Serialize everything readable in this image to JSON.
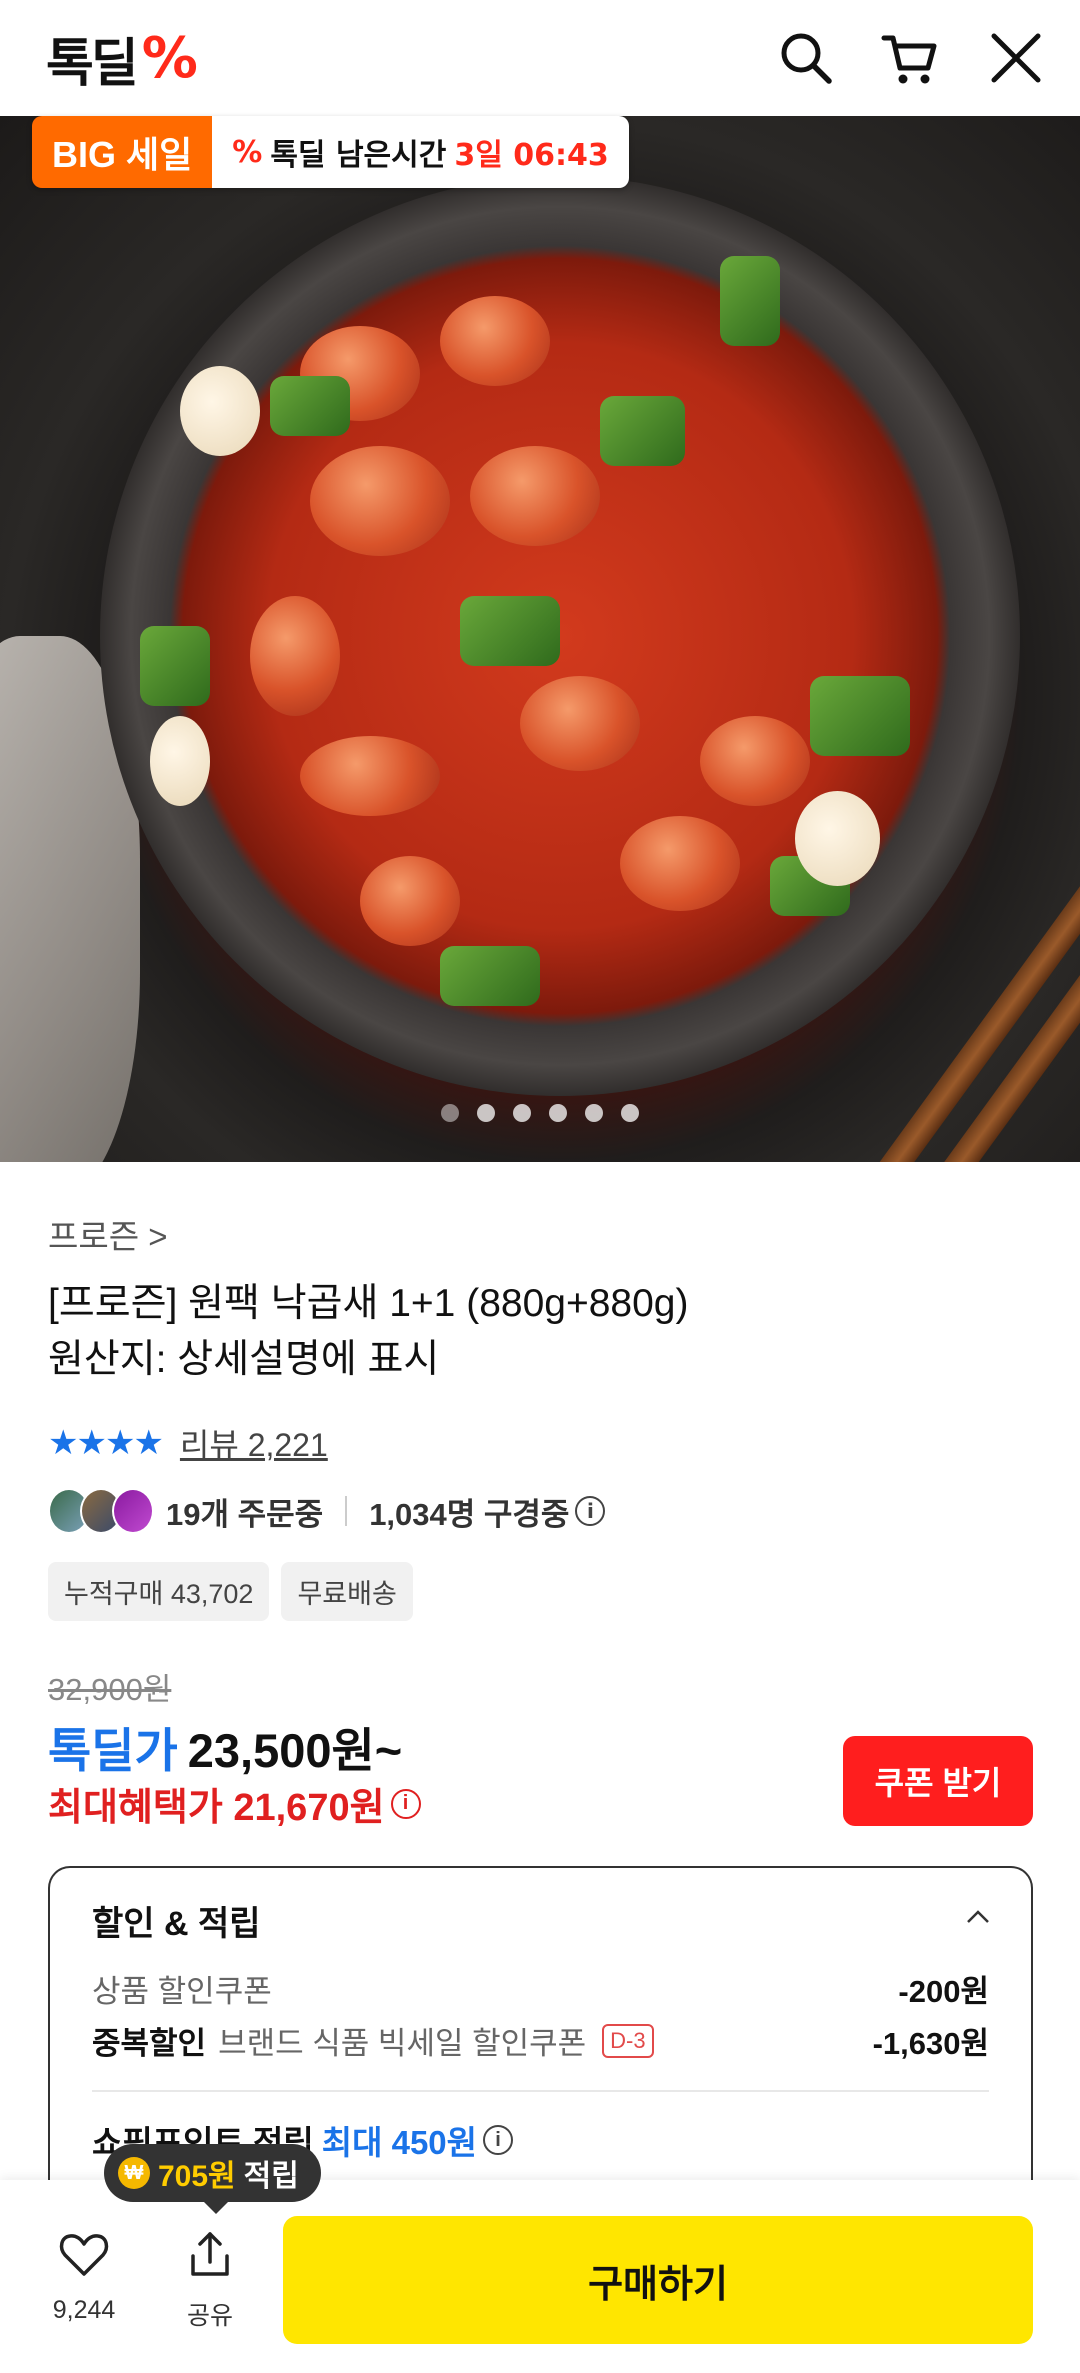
{
  "header": {
    "logo_text": "톡딜",
    "logo_symbol": "%",
    "icons": [
      "search-icon",
      "cart-icon",
      "close-icon"
    ]
  },
  "hero": {
    "sale_badge": "BIG 세일",
    "timer_label": "톡딜 남은시간",
    "timer_value": "3일 06:43",
    "carousel_count": 6
  },
  "product": {
    "category": "프로즌 >",
    "title_line1": "[프로즌] 원팩 낙곱새 1+1 (880g+880g)",
    "title_line2": "원산지: 상세설명에 표시",
    "stars": "★★★★",
    "review_label": "리뷰 2,221",
    "orders_text": "19개 주문중",
    "viewers_text": "1,034명 구경중",
    "chips": [
      "누적구매 43,702",
      "무료배송"
    ]
  },
  "price": {
    "original": "32,900원",
    "deal_label": "톡딜가",
    "deal_price": "23,500원~",
    "max_benefit": "최대혜택가 21,670원",
    "coupon_button": "쿠폰 받기"
  },
  "discount": {
    "heading": "할인 & 적립",
    "rows": [
      {
        "label": "상품 할인쿠폰",
        "bold": "",
        "tag": "",
        "amount": "-200원"
      },
      {
        "label": "브랜드 식품 빅세일 할인쿠폰",
        "bold": "중복할인",
        "tag": "D-3",
        "amount": "-1,630원"
      }
    ],
    "points_label": "쇼핑포인트 적립",
    "points_max": "최대 450원"
  },
  "bottom": {
    "tooltip_amount": "705원",
    "tooltip_suffix": "적립",
    "like_count": "9,244",
    "share_label": "공유",
    "buy_label": "구매하기"
  },
  "colors": {
    "accent_blue": "#1a73e8",
    "accent_red": "#e02020",
    "buy_yellow": "#ffe600",
    "badge_orange": "#ff6a00"
  }
}
